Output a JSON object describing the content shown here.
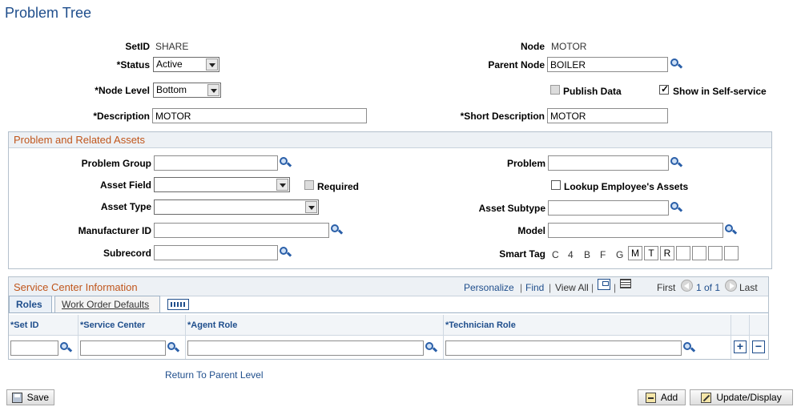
{
  "page_title": "Problem Tree",
  "header": {
    "setid_label": "SetID",
    "setid_value": "SHARE",
    "node_label": "Node",
    "node_value": "MOTOR",
    "status_label": "*Status",
    "status_value": "Active",
    "parent_node_label": "Parent Node",
    "parent_node_value": "BOILER",
    "node_level_label": "*Node Level",
    "node_level_value": "Bottom",
    "publish_data_label": "Publish Data",
    "publish_data_checked": false,
    "show_self_service_label": "Show in Self-service",
    "show_self_service_checked": true,
    "description_label": "*Description",
    "description_value": "MOTOR",
    "short_description_label": "*Short Description",
    "short_description_value": "MOTOR"
  },
  "assets_group": {
    "title": "Problem and Related Assets",
    "problem_group_label": "Problem Group",
    "problem_group_value": "",
    "problem_label": "Problem",
    "problem_value": "",
    "asset_field_label": "Asset Field",
    "asset_field_value": "",
    "required_label": "Required",
    "lookup_employee_label": "Lookup Employee's Assets",
    "asset_type_label": "Asset Type",
    "asset_type_value": "",
    "asset_subtype_label": "Asset Subtype",
    "asset_subtype_value": "",
    "manufacturer_label": "Manufacturer ID",
    "manufacturer_value": "",
    "model_label": "Model",
    "model_value": "",
    "subrecord_label": "Subrecord",
    "subrecord_value": "",
    "smart_tag_label": "Smart Tag",
    "smart_tag_letters": [
      "C",
      "4",
      "B",
      "F",
      "G"
    ],
    "smart_tag_cells": [
      "M",
      "T",
      "R",
      "",
      "",
      "",
      "",
      ""
    ]
  },
  "service_center": {
    "title": "Service Center Information",
    "personalize": "Personalize",
    "find": "Find",
    "view_all": "View All",
    "first": "First",
    "range": "1 of 1",
    "last": "Last",
    "tabs": [
      "Roles",
      "Work Order Defaults"
    ],
    "columns": [
      "*Set ID",
      "*Service Center",
      "*Agent Role",
      "*Technician Role"
    ],
    "row": [
      "",
      "",
      "",
      ""
    ]
  },
  "return_link": "Return To Parent Level",
  "buttons": {
    "save": "Save",
    "add": "Add",
    "update_display": "Update/Display"
  }
}
